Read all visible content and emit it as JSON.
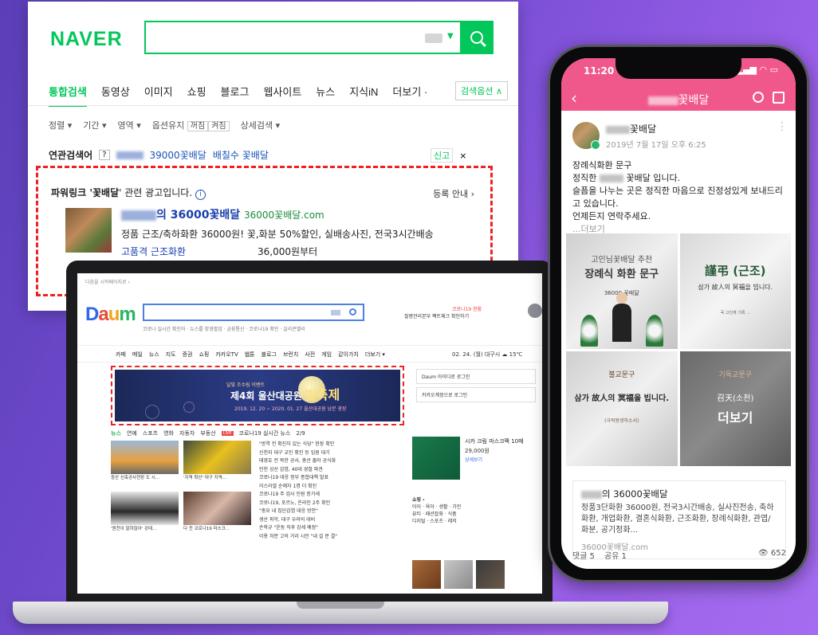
{
  "naver": {
    "logo": "NAVER",
    "tabs": [
      "통합검색",
      "동영상",
      "이미지",
      "쇼핑",
      "블로그",
      "웹사이트",
      "뉴스",
      "지식iN",
      "더보기 ·"
    ],
    "search_options_label": "검색옵션 ∧",
    "filters": [
      "정렬 ▾",
      "기간 ▾",
      "영역 ▾",
      "옵션유지",
      "꺼짐",
      "켜짐",
      "상세검색 ▾"
    ],
    "related": {
      "label": "연관검색어",
      "help": "?",
      "items": [
        "39000꽃배달",
        "배칠수 꽃배달"
      ],
      "report_label": "신고",
      "close": "×"
    },
    "ad": {
      "header_prefix": "파워링크 '",
      "header_keyword": "꽃배달",
      "header_suffix": "' 관련 광고입니다.",
      "info_icon": "i",
      "register_label": "등록 안내 ›",
      "title": "의 36000꽃배달",
      "url": "36000꽃배달.com",
      "description": "정품 근조/축하화환 36000원! 꽃,화분 50%할인, 실배송사진, 전국3시간배송",
      "sublink": "고품격 근조화환",
      "price": "36,000원부터"
    }
  },
  "daum": {
    "top_note": "다음을 시작페이지로 ›",
    "logo": [
      "D",
      "a",
      "u",
      "m"
    ],
    "search_sub": "코로나 실시간 확진자 · 뉴스를 망영팝업 · 금융통신 · 코로나19 확인 · 실리콘밸리",
    "side_note": "코로나19 현황",
    "side_note2": "질병관리본부 팩트체크 확인하기",
    "nav": [
      "카페",
      "메일",
      "뉴스",
      "지도",
      "증권",
      "쇼핑",
      "카카오TV",
      "웹툰",
      "블로그",
      "브런치",
      "사전",
      "게임",
      "같이가치",
      "더보기 ▾"
    ],
    "date": "02. 24. (월)   대구시 ☁ 15℃",
    "banner": {
      "t1": "달빛 조수림 이벤트",
      "t2": "제4회 울산대공원",
      "t3": "빛축제",
      "t4": "2019. 12. 20 ~ 2020. 01. 27 울산대공원 남문 광장"
    },
    "login_items": [
      "Daum 아이디로 로그인",
      "카카오계정으로 로그인"
    ],
    "news_header": [
      "뉴스",
      "연예",
      "스포츠",
      "영화",
      "자동차",
      "부동산"
    ],
    "live_badge": "LIVE",
    "live_text": "코로나19 실시간 뉴스",
    "page": "2/9",
    "thumb_captions": [
      "중산 신축공사현장 도 시...",
      "'지역 확산' 대구 지역...",
      "'원천이 말하잖아' 강태...",
      "다 전 코로나19 마스크..."
    ],
    "news_lines": [
      "\"방역 전 확진자 있는 식당\" 현장 확인",
      "신천지 대구 교인 확진 등 입원 대기",
      "태영호 전 북한 공사, 총선 출마 공식화",
      "인천 상산 감염, 40대 경찰 파견",
      "코로나19 대응 정부 종합대책 발표",
      "이스라엘 순례자 1명 더 확진",
      "코로나19 주 검사 인원 증가세",
      "코로나19, 포르노, 온라인 2주 확인",
      "\"중요 내 집단감염 대응 방안\"",
      "생산 파악, 대구 우려의 대비",
      "손학규 \"운동 직후 강세 예정\"",
      "이용 처분 고의 거리 시민 \"내 걸 문 결\""
    ],
    "card": {
      "title": "시카 크림 마스크팩 10매",
      "price": "29,000원",
      "link": "상세보기"
    },
    "shop_label": "쇼핑 ›",
    "shop_lines": [
      "아이 · 육아 · 생활 · 가전",
      "뷰티 · 패션잡화 · 식품",
      "디지털 · 스포츠 · 레저"
    ]
  },
  "phone": {
    "time": "11:20",
    "status": "▂▄▆ ◠ ▭",
    "back": "‹",
    "title": "꽃배달",
    "author_suffix": "꽃배달",
    "date": "2019년 7월 17일 오후 6:25",
    "more_dots": "⋮",
    "body": [
      "장례식화환 문구",
      "꽃배달 입니다.",
      "슬픔을 나누는 곳은 정직한 마음으로 진정성있게 보내드리고 있습니다.",
      "언제든지 연락주세요."
    ],
    "body_prefix": "정직한",
    "more": "...더보기",
    "cells": [
      {
        "t1": "고인님꽃배달 추천",
        "t2": "장례식 화환 문구",
        "t3": "36000 꽃배달"
      },
      {
        "t1": "謹弔 (근조)",
        "t2": "삼가 故人의 冥福을 빕니다.",
        "t3": "꼭 고인께 기록 ..."
      },
      {
        "t1": "불교문구",
        "t2": "삼가 故人의 冥福을 빕니다.",
        "t3": "(극락왕생하소서)"
      },
      {
        "t1": "기독교문구",
        "t2": "召天(소천)",
        "t3": "더보기"
      }
    ],
    "link_title": "의 36000꽃배달",
    "link_desc": "정품3단화환 36000원, 전국3시간배송, 실사진전송, 축하화환, 개업화환, 결혼식화환, 근조화환, 장례식화환, 관엽/화분, 공기정화...",
    "link_url": "36000꽃배달.com",
    "comments": "댓글 5",
    "shares": "공유 1",
    "views": "👁 652"
  }
}
